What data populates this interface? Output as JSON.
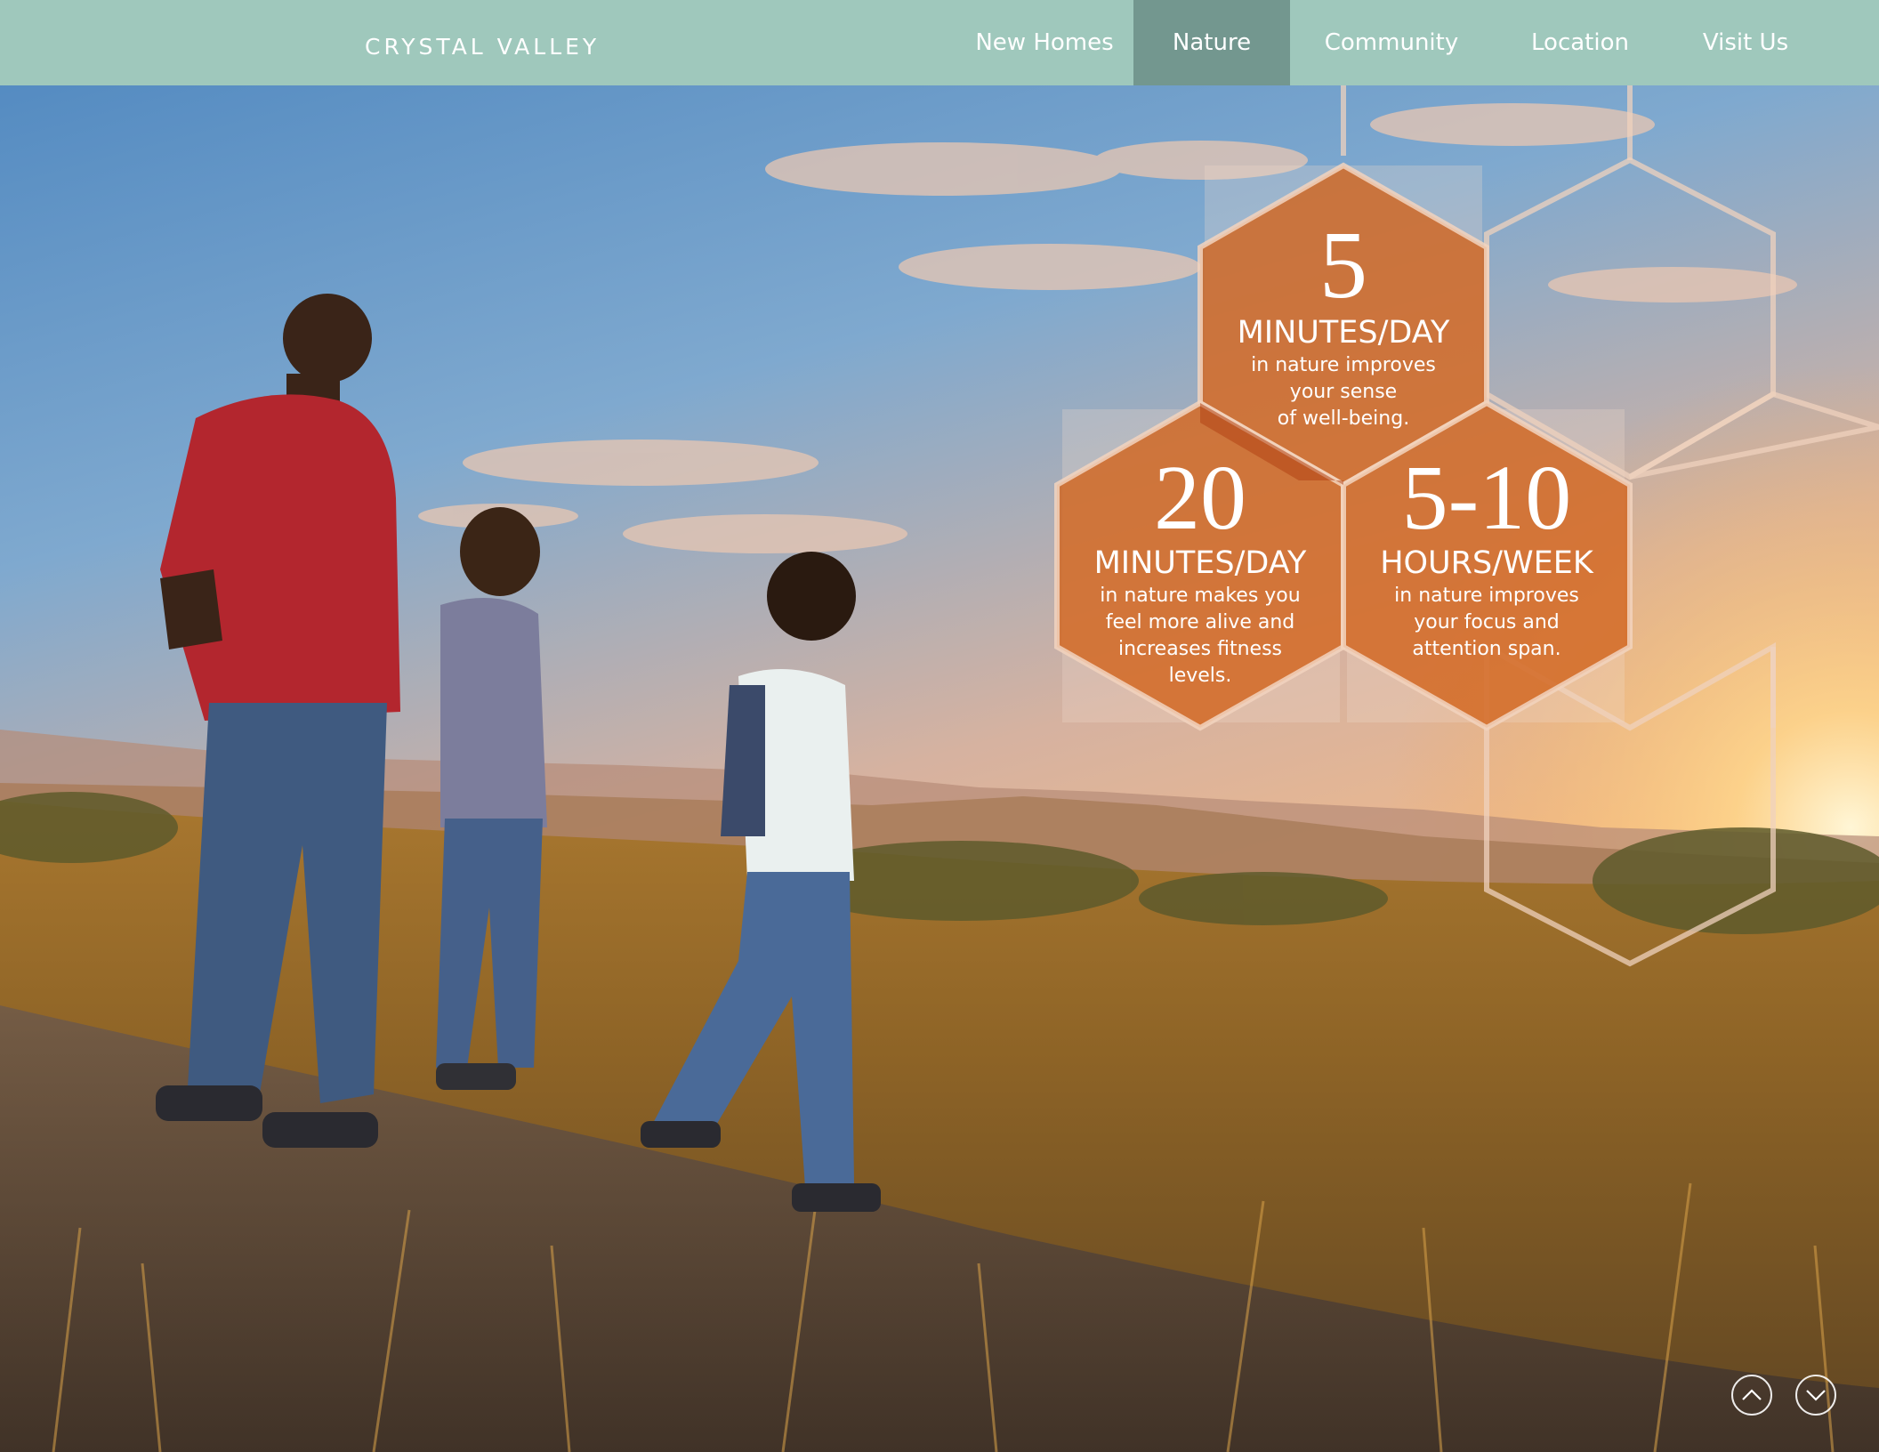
{
  "header": {
    "brand": "CRYSTAL VALLEY",
    "nav": [
      {
        "label": "New Homes",
        "active": false
      },
      {
        "label": "Nature",
        "active": true
      },
      {
        "label": "Community",
        "active": false
      },
      {
        "label": "Location",
        "active": false
      },
      {
        "label": "Visit Us",
        "active": false
      }
    ]
  },
  "stats": [
    {
      "number": "5",
      "unit": "MINUTES/DAY",
      "description_lines": [
        "in nature improves",
        "your sense",
        "of well-being."
      ]
    },
    {
      "number": "20",
      "unit": "MINUTES/DAY",
      "description_lines": [
        "in nature makes you",
        "feel more alive and",
        "increases fitness",
        "levels."
      ]
    },
    {
      "number": "5-10",
      "unit": "HOURS/WEEK",
      "description_lines": [
        "in nature improves",
        "your focus and",
        "attention span."
      ]
    }
  ],
  "controls": {
    "scroll_up_icon": "chevron-up-icon",
    "scroll_down_icon": "chevron-down-icon"
  },
  "colors": {
    "header_bg": "#9fc8bc",
    "nav_active_bg": "#73978f",
    "hex_orange": "#d2651f",
    "text_light": "#ffffff"
  }
}
